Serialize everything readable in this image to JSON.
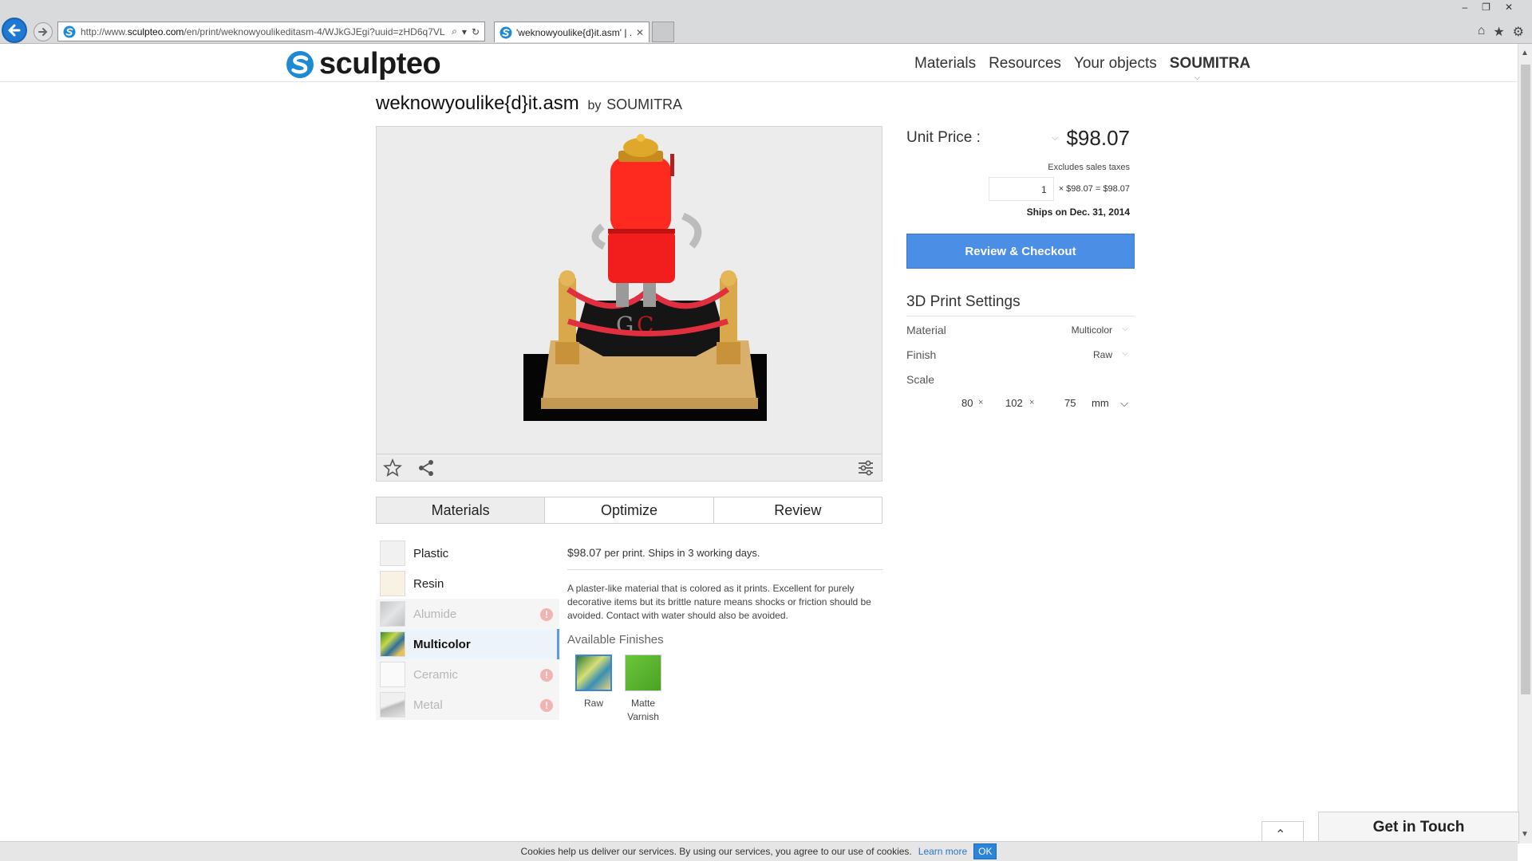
{
  "browser": {
    "url_prefix": "http://www.",
    "url_domain": "sculpteo.com",
    "url_rest": "/en/print/weknowyoulikeditasm-4/WJkGJEgi?uuid=zHD6q7VL",
    "tab_title": "'weknowyoulike{d}it.asm' | ...",
    "tab_close": "✕"
  },
  "header": {
    "logo_text": "sculpteo",
    "nav": [
      "Materials",
      "Resources",
      "Your objects"
    ],
    "user": "SOUMITRA"
  },
  "object": {
    "title": "weknowyoulike{d}it.asm",
    "by": "by",
    "author": "SOUMITRA"
  },
  "tabs": [
    {
      "label": "Materials",
      "active": true
    },
    {
      "label": "Optimize",
      "active": false
    },
    {
      "label": "Review",
      "active": false
    }
  ],
  "materials": [
    {
      "label": "Plastic",
      "state": "enabled",
      "swatch": "#f1f1f1"
    },
    {
      "label": "Resin",
      "state": "enabled",
      "swatch": "#f7f2e4"
    },
    {
      "label": "Alumide",
      "state": "disabled",
      "swatch": "#cfd1d3"
    },
    {
      "label": "Multicolor",
      "state": "selected",
      "swatch": "multicolor"
    },
    {
      "label": "Ceramic",
      "state": "disabled",
      "swatch": "#fafafa"
    },
    {
      "label": "Metal",
      "state": "disabled",
      "swatch": "#d9d9d9"
    }
  ],
  "material_info": {
    "price": "$98.07",
    "price_suffix": "per print. Ships in 3 working days.",
    "description": "A plaster-like material that is colored as it prints. Excellent for purely decorative items but its brittle nature means shocks or friction should be avoided. Contact with water should also be avoided.",
    "finishes_title": "Available Finishes",
    "finishes": [
      {
        "label": "Raw",
        "selected": true
      },
      {
        "label": "Matte Varnish",
        "selected": false
      }
    ]
  },
  "pricing": {
    "unit_label": "Unit Price :",
    "unit_price": "$98.07",
    "excludes": "Excludes sales taxes",
    "quantity": "1",
    "calc": "× $98.07 = $98.07",
    "ships": "Ships on Dec. 31, 2014",
    "checkout": "Review & Checkout"
  },
  "settings": {
    "title": "3D Print Settings",
    "material_label": "Material",
    "material_value": "Multicolor",
    "finish_label": "Finish",
    "finish_value": "Raw",
    "scale_label": "Scale",
    "scale_x": "80",
    "scale_y": "102",
    "scale_z": "75",
    "scale_sep": "×",
    "scale_unit": "mm"
  },
  "footer": {
    "get_in_touch": "Get in Touch",
    "cookie_text": "Cookies help us deliver our services. By using our services, you agree to our use of cookies.",
    "cookie_link": "Learn more",
    "cookie_ok": "OK"
  },
  "colors": {
    "accent": "#4a8ee6",
    "logo_blue": "#1d8ad6",
    "selected_bg": "#edf3fb",
    "warning": "#f2b3b3"
  },
  "icons": [
    "back-icon",
    "forward-icon",
    "search-icon",
    "refresh-icon",
    "home-icon",
    "favorites-icon",
    "settings-icon",
    "star-icon",
    "share-icon",
    "sliders-icon",
    "warning-icon",
    "chevron-down-icon",
    "chevron-up-icon"
  ]
}
